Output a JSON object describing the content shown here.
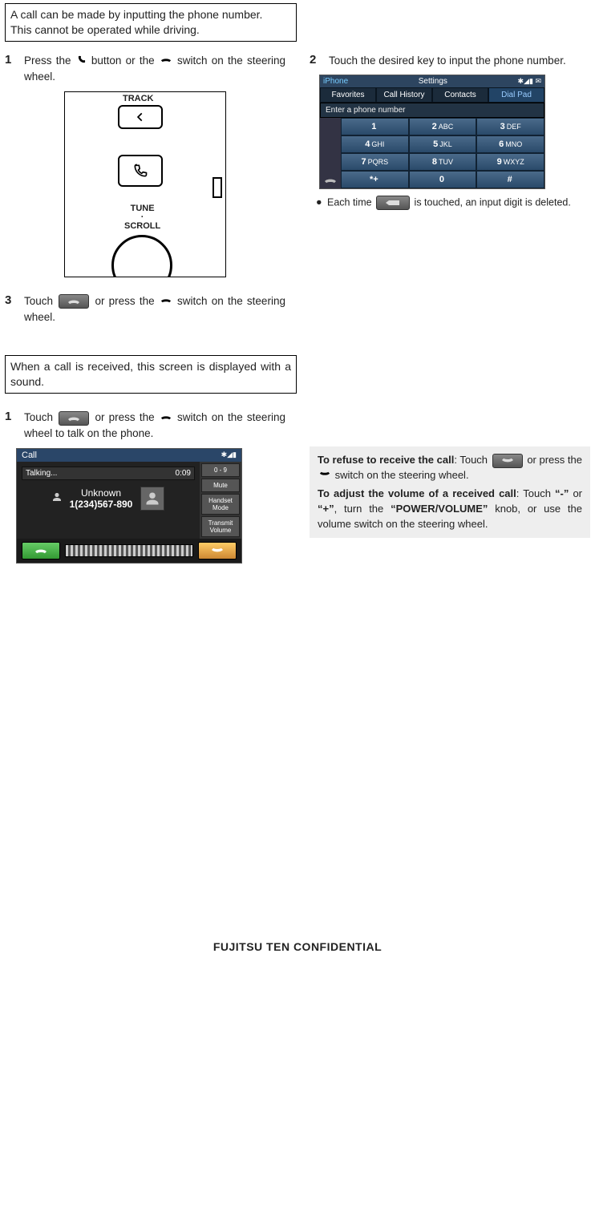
{
  "intro1": {
    "line1": "A call can be made by inputting the phone number.",
    "line2": "This cannot be operated while driving."
  },
  "step1": {
    "num": "1",
    "text_a": "Press the ",
    "text_b": " button or the ",
    "text_c": " switch on the steering wheel."
  },
  "wheel": {
    "track": "TRACK",
    "tune": "TUNE",
    "scroll": "SCROLL"
  },
  "step2": {
    "num": "2",
    "text": "Touch the desired key to input the phone number."
  },
  "dial": {
    "device": "iPhone",
    "settings": "Settings",
    "tabs": [
      "Favorites",
      "Call History",
      "Contacts",
      "Dial Pad"
    ],
    "active_tab": 3,
    "placeholder": "Enter a phone number",
    "keys": [
      {
        "n": "1",
        "l": ""
      },
      {
        "n": "2",
        "l": "ABC"
      },
      {
        "n": "3",
        "l": "DEF"
      },
      {
        "n": "4",
        "l": "GHI"
      },
      {
        "n": "5",
        "l": "JKL"
      },
      {
        "n": "6",
        "l": "MNO"
      },
      {
        "n": "7",
        "l": "PQRS"
      },
      {
        "n": "8",
        "l": "TUV"
      },
      {
        "n": "9",
        "l": "WXYZ"
      },
      {
        "n": "*+",
        "l": ""
      },
      {
        "n": "0",
        "l": ""
      },
      {
        "n": "#",
        "l": ""
      }
    ]
  },
  "note1": {
    "bullet": "●",
    "a": "Each time ",
    "b": " is touched, an input digit is deleted."
  },
  "step3": {
    "num": "3",
    "a": "Touch ",
    "b": " or press the ",
    "c": " switch on the steering wheel."
  },
  "intro2": "When a call is received, this screen is displayed with a sound.",
  "step4": {
    "num": "1",
    "a": "Touch ",
    "b": " or press the ",
    "c": " switch on the steering wheel to talk on the phone."
  },
  "call": {
    "title": "Call",
    "status": "Talking...",
    "time": "0:09",
    "name": "Unknown",
    "number": "1(234)567-890",
    "side": [
      "0 - 9",
      "Mute",
      "Handset Mode",
      "Transmit Volume"
    ]
  },
  "info": {
    "refuse_bold": "To refuse to receive the call",
    "refuse_a": ": Touch ",
    "refuse_b": " or press the ",
    "refuse_c": " switch on the steering wheel.",
    "vol_bold": "To adjust the volume of a received call",
    "vol_a": ": Touch ",
    "vol_minus": "“-”",
    "vol_or": " or ",
    "vol_plus": "“+”",
    "vol_b": ", turn the ",
    "vol_knob": "“POWER/VOLUME”",
    "vol_c": " knob, or use the volume switch on the steering wheel."
  },
  "footer": "FUJITSU TEN CONFIDENTIAL"
}
